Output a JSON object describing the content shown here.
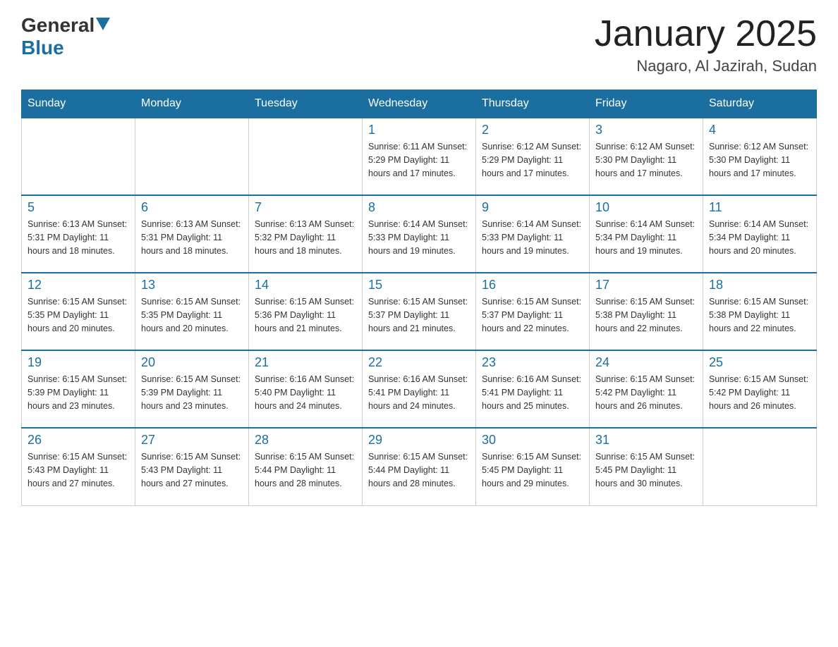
{
  "header": {
    "logo_general": "General",
    "logo_blue": "Blue",
    "month_title": "January 2025",
    "location": "Nagaro, Al Jazirah, Sudan"
  },
  "days_of_week": [
    "Sunday",
    "Monday",
    "Tuesday",
    "Wednesday",
    "Thursday",
    "Friday",
    "Saturday"
  ],
  "weeks": [
    [
      {
        "day": "",
        "info": ""
      },
      {
        "day": "",
        "info": ""
      },
      {
        "day": "",
        "info": ""
      },
      {
        "day": "1",
        "info": "Sunrise: 6:11 AM\nSunset: 5:29 PM\nDaylight: 11 hours and 17 minutes."
      },
      {
        "day": "2",
        "info": "Sunrise: 6:12 AM\nSunset: 5:29 PM\nDaylight: 11 hours and 17 minutes."
      },
      {
        "day": "3",
        "info": "Sunrise: 6:12 AM\nSunset: 5:30 PM\nDaylight: 11 hours and 17 minutes."
      },
      {
        "day": "4",
        "info": "Sunrise: 6:12 AM\nSunset: 5:30 PM\nDaylight: 11 hours and 17 minutes."
      }
    ],
    [
      {
        "day": "5",
        "info": "Sunrise: 6:13 AM\nSunset: 5:31 PM\nDaylight: 11 hours and 18 minutes."
      },
      {
        "day": "6",
        "info": "Sunrise: 6:13 AM\nSunset: 5:31 PM\nDaylight: 11 hours and 18 minutes."
      },
      {
        "day": "7",
        "info": "Sunrise: 6:13 AM\nSunset: 5:32 PM\nDaylight: 11 hours and 18 minutes."
      },
      {
        "day": "8",
        "info": "Sunrise: 6:14 AM\nSunset: 5:33 PM\nDaylight: 11 hours and 19 minutes."
      },
      {
        "day": "9",
        "info": "Sunrise: 6:14 AM\nSunset: 5:33 PM\nDaylight: 11 hours and 19 minutes."
      },
      {
        "day": "10",
        "info": "Sunrise: 6:14 AM\nSunset: 5:34 PM\nDaylight: 11 hours and 19 minutes."
      },
      {
        "day": "11",
        "info": "Sunrise: 6:14 AM\nSunset: 5:34 PM\nDaylight: 11 hours and 20 minutes."
      }
    ],
    [
      {
        "day": "12",
        "info": "Sunrise: 6:15 AM\nSunset: 5:35 PM\nDaylight: 11 hours and 20 minutes."
      },
      {
        "day": "13",
        "info": "Sunrise: 6:15 AM\nSunset: 5:35 PM\nDaylight: 11 hours and 20 minutes."
      },
      {
        "day": "14",
        "info": "Sunrise: 6:15 AM\nSunset: 5:36 PM\nDaylight: 11 hours and 21 minutes."
      },
      {
        "day": "15",
        "info": "Sunrise: 6:15 AM\nSunset: 5:37 PM\nDaylight: 11 hours and 21 minutes."
      },
      {
        "day": "16",
        "info": "Sunrise: 6:15 AM\nSunset: 5:37 PM\nDaylight: 11 hours and 22 minutes."
      },
      {
        "day": "17",
        "info": "Sunrise: 6:15 AM\nSunset: 5:38 PM\nDaylight: 11 hours and 22 minutes."
      },
      {
        "day": "18",
        "info": "Sunrise: 6:15 AM\nSunset: 5:38 PM\nDaylight: 11 hours and 22 minutes."
      }
    ],
    [
      {
        "day": "19",
        "info": "Sunrise: 6:15 AM\nSunset: 5:39 PM\nDaylight: 11 hours and 23 minutes."
      },
      {
        "day": "20",
        "info": "Sunrise: 6:15 AM\nSunset: 5:39 PM\nDaylight: 11 hours and 23 minutes."
      },
      {
        "day": "21",
        "info": "Sunrise: 6:16 AM\nSunset: 5:40 PM\nDaylight: 11 hours and 24 minutes."
      },
      {
        "day": "22",
        "info": "Sunrise: 6:16 AM\nSunset: 5:41 PM\nDaylight: 11 hours and 24 minutes."
      },
      {
        "day": "23",
        "info": "Sunrise: 6:16 AM\nSunset: 5:41 PM\nDaylight: 11 hours and 25 minutes."
      },
      {
        "day": "24",
        "info": "Sunrise: 6:15 AM\nSunset: 5:42 PM\nDaylight: 11 hours and 26 minutes."
      },
      {
        "day": "25",
        "info": "Sunrise: 6:15 AM\nSunset: 5:42 PM\nDaylight: 11 hours and 26 minutes."
      }
    ],
    [
      {
        "day": "26",
        "info": "Sunrise: 6:15 AM\nSunset: 5:43 PM\nDaylight: 11 hours and 27 minutes."
      },
      {
        "day": "27",
        "info": "Sunrise: 6:15 AM\nSunset: 5:43 PM\nDaylight: 11 hours and 27 minutes."
      },
      {
        "day": "28",
        "info": "Sunrise: 6:15 AM\nSunset: 5:44 PM\nDaylight: 11 hours and 28 minutes."
      },
      {
        "day": "29",
        "info": "Sunrise: 6:15 AM\nSunset: 5:44 PM\nDaylight: 11 hours and 28 minutes."
      },
      {
        "day": "30",
        "info": "Sunrise: 6:15 AM\nSunset: 5:45 PM\nDaylight: 11 hours and 29 minutes."
      },
      {
        "day": "31",
        "info": "Sunrise: 6:15 AM\nSunset: 5:45 PM\nDaylight: 11 hours and 30 minutes."
      },
      {
        "day": "",
        "info": ""
      }
    ]
  ]
}
